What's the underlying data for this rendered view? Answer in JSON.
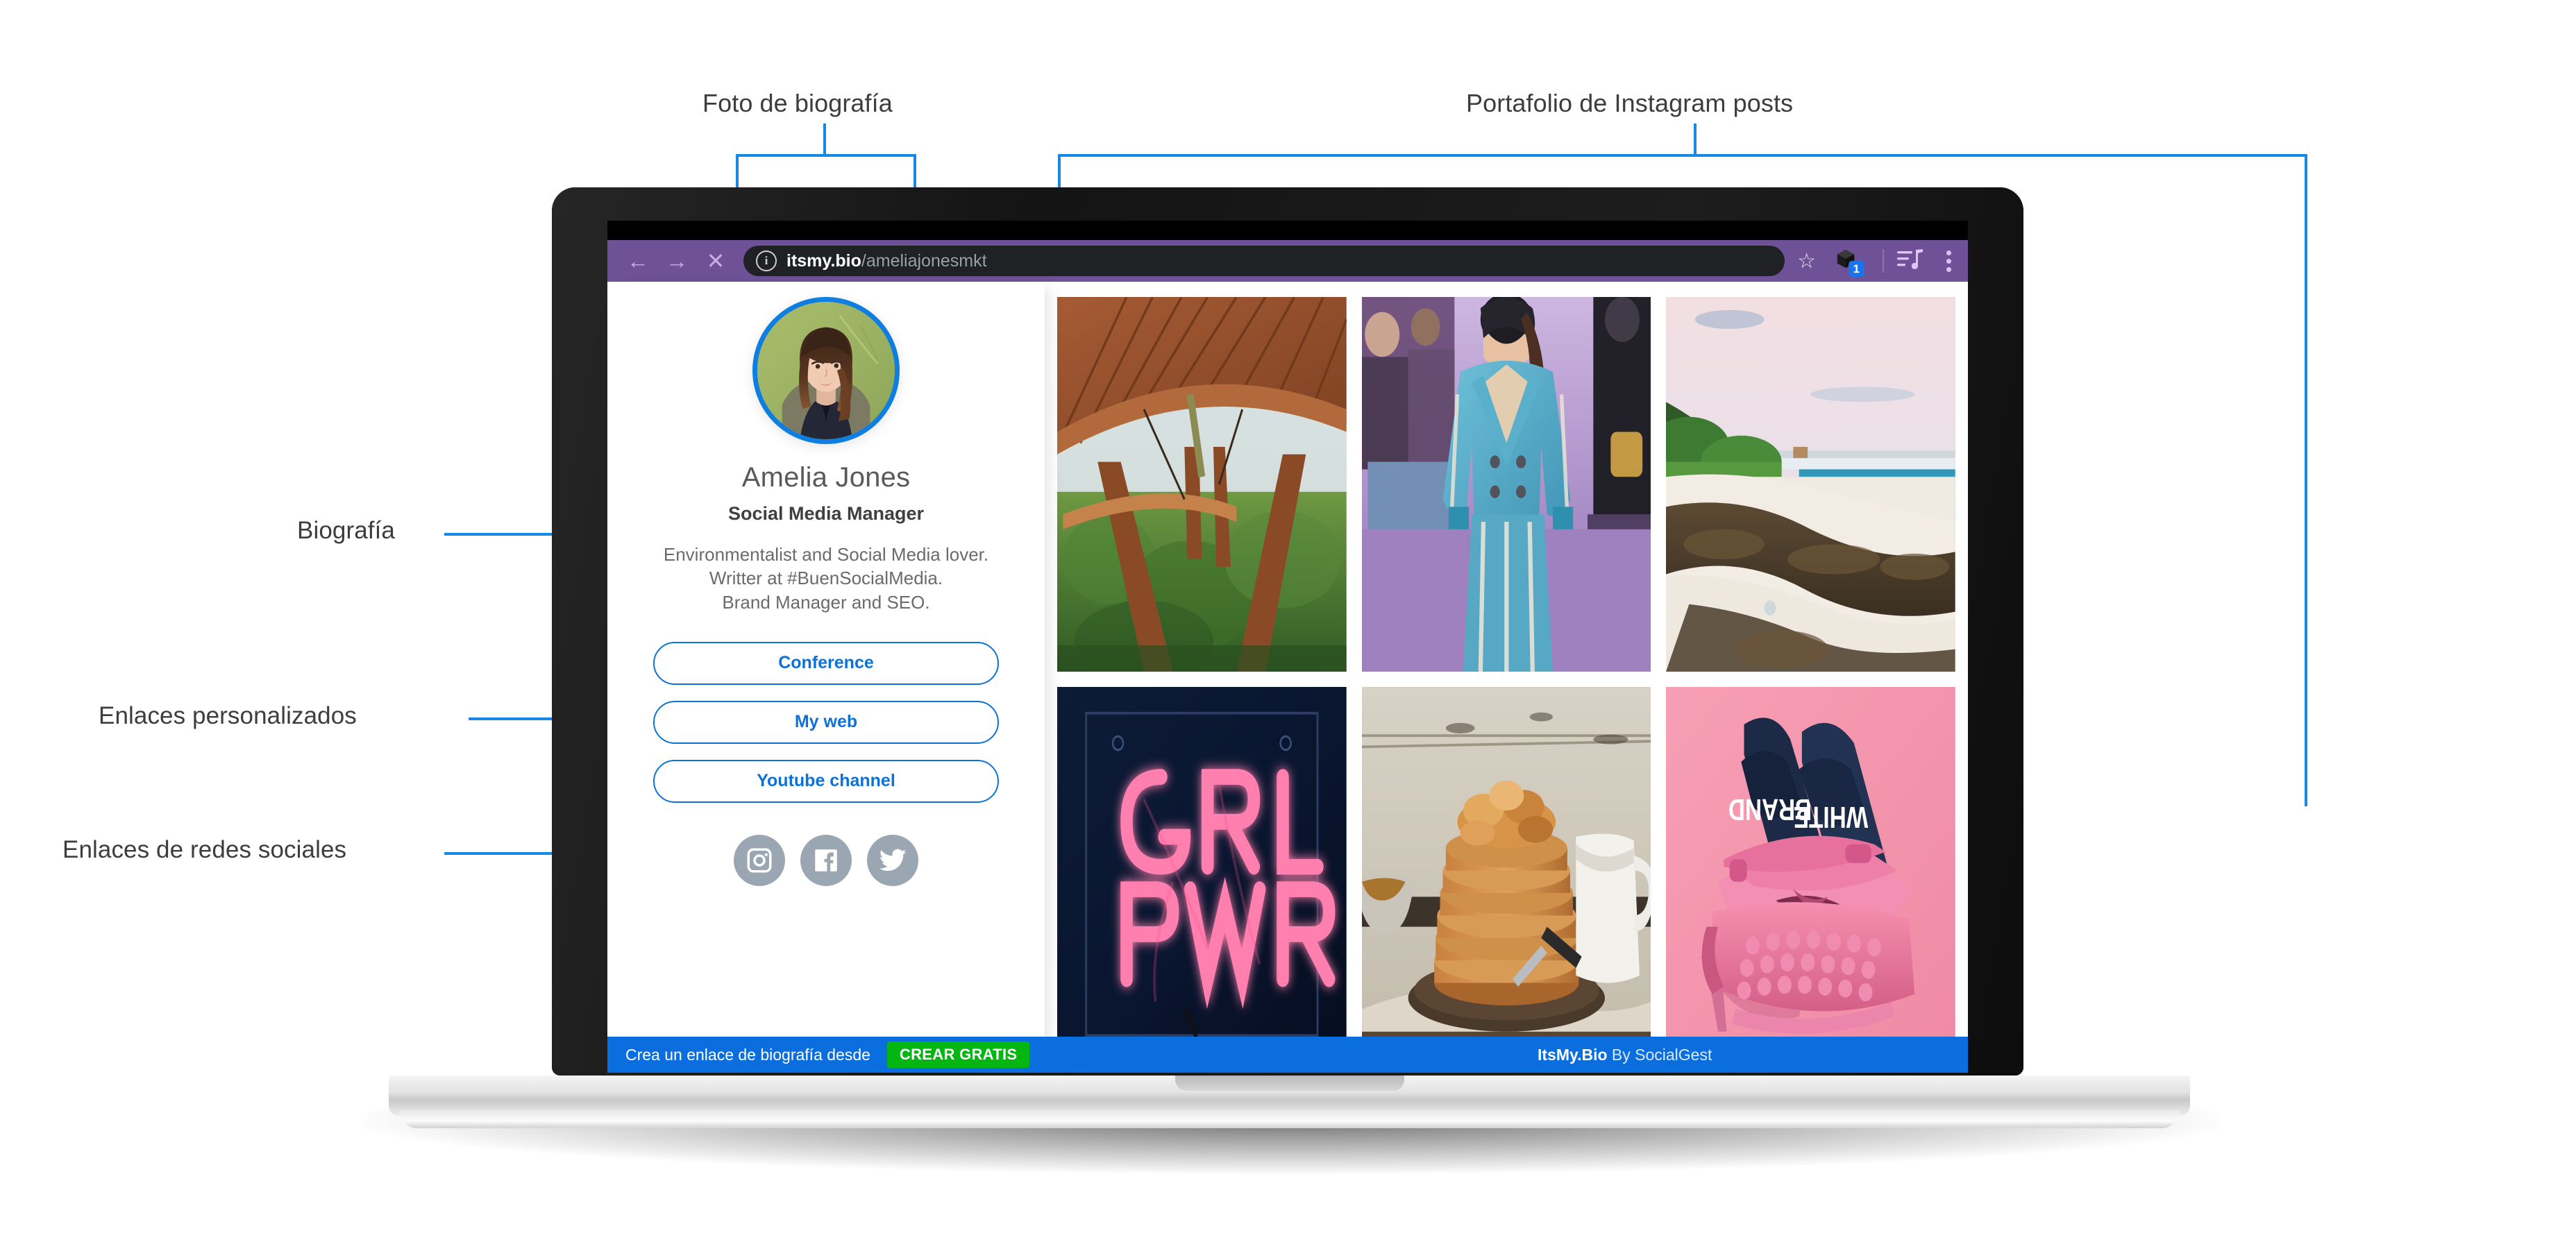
{
  "annotations": {
    "photo": "Foto de biografía",
    "portfolio": "Portafolio de Instagram posts",
    "bio": "Biografía",
    "custom_links": "Enlaces personalizados",
    "social_links": "Enlaces de redes sociales"
  },
  "browser": {
    "back_icon": "arrow-left-icon",
    "forward_icon": "arrow-right-icon",
    "stop_icon": "close-icon",
    "security_icon": "info-circle-icon",
    "url_domain": "itsmy.bio",
    "url_path": "/ameliajonesmkt",
    "bookmark_icon": "star-icon",
    "extension_icon": "extension-cube-icon",
    "extension_badge": "1",
    "reading_list_icon": "playlist-music-icon",
    "menu_icon": "three-dots-menu-icon",
    "toolbar_color": "#6e5196",
    "urlbar_color": "#202124"
  },
  "profile": {
    "avatar_alt": "avatar-photo",
    "name": "Amelia Jones",
    "role": "Social Media Manager",
    "bio_line1": "Environmentalist and Social Media lover.",
    "bio_line2": "Writter at #BuenSocialMedia.",
    "bio_line3": "Brand Manager and SEO.",
    "accent_color": "#0c72d8"
  },
  "links": [
    {
      "label": "Conference"
    },
    {
      "label": "My web"
    },
    {
      "label": "Youtube channel"
    }
  ],
  "socials": [
    {
      "name": "instagram-icon"
    },
    {
      "name": "facebook-icon"
    },
    {
      "name": "twitter-icon"
    }
  ],
  "posts": [
    {
      "alt": "bamboo-pavilion-jungle-photo"
    },
    {
      "alt": "runway-denim-fashion-photo"
    },
    {
      "alt": "beach-seaweed-shoreline-photo"
    },
    {
      "alt": "grl-pwr-neon-sign-photo",
      "caption_line1": "GRL",
      "caption_line2": "PWR"
    },
    {
      "alt": "pancake-stack-breakfast-photo"
    },
    {
      "alt": "pink-typewriter-sandals-photo",
      "slide_left_text": "BRAND",
      "slide_right_text": "WHITE"
    }
  ],
  "footer": {
    "cta_text": "Crea un enlace de biografía desde",
    "cta_button": "CREAR GRATIS",
    "brand_name": "ItsMy.Bio",
    "brand_suffix": " By SocialGest",
    "bar_color": "#0a6ede",
    "button_color": "#04b612"
  }
}
